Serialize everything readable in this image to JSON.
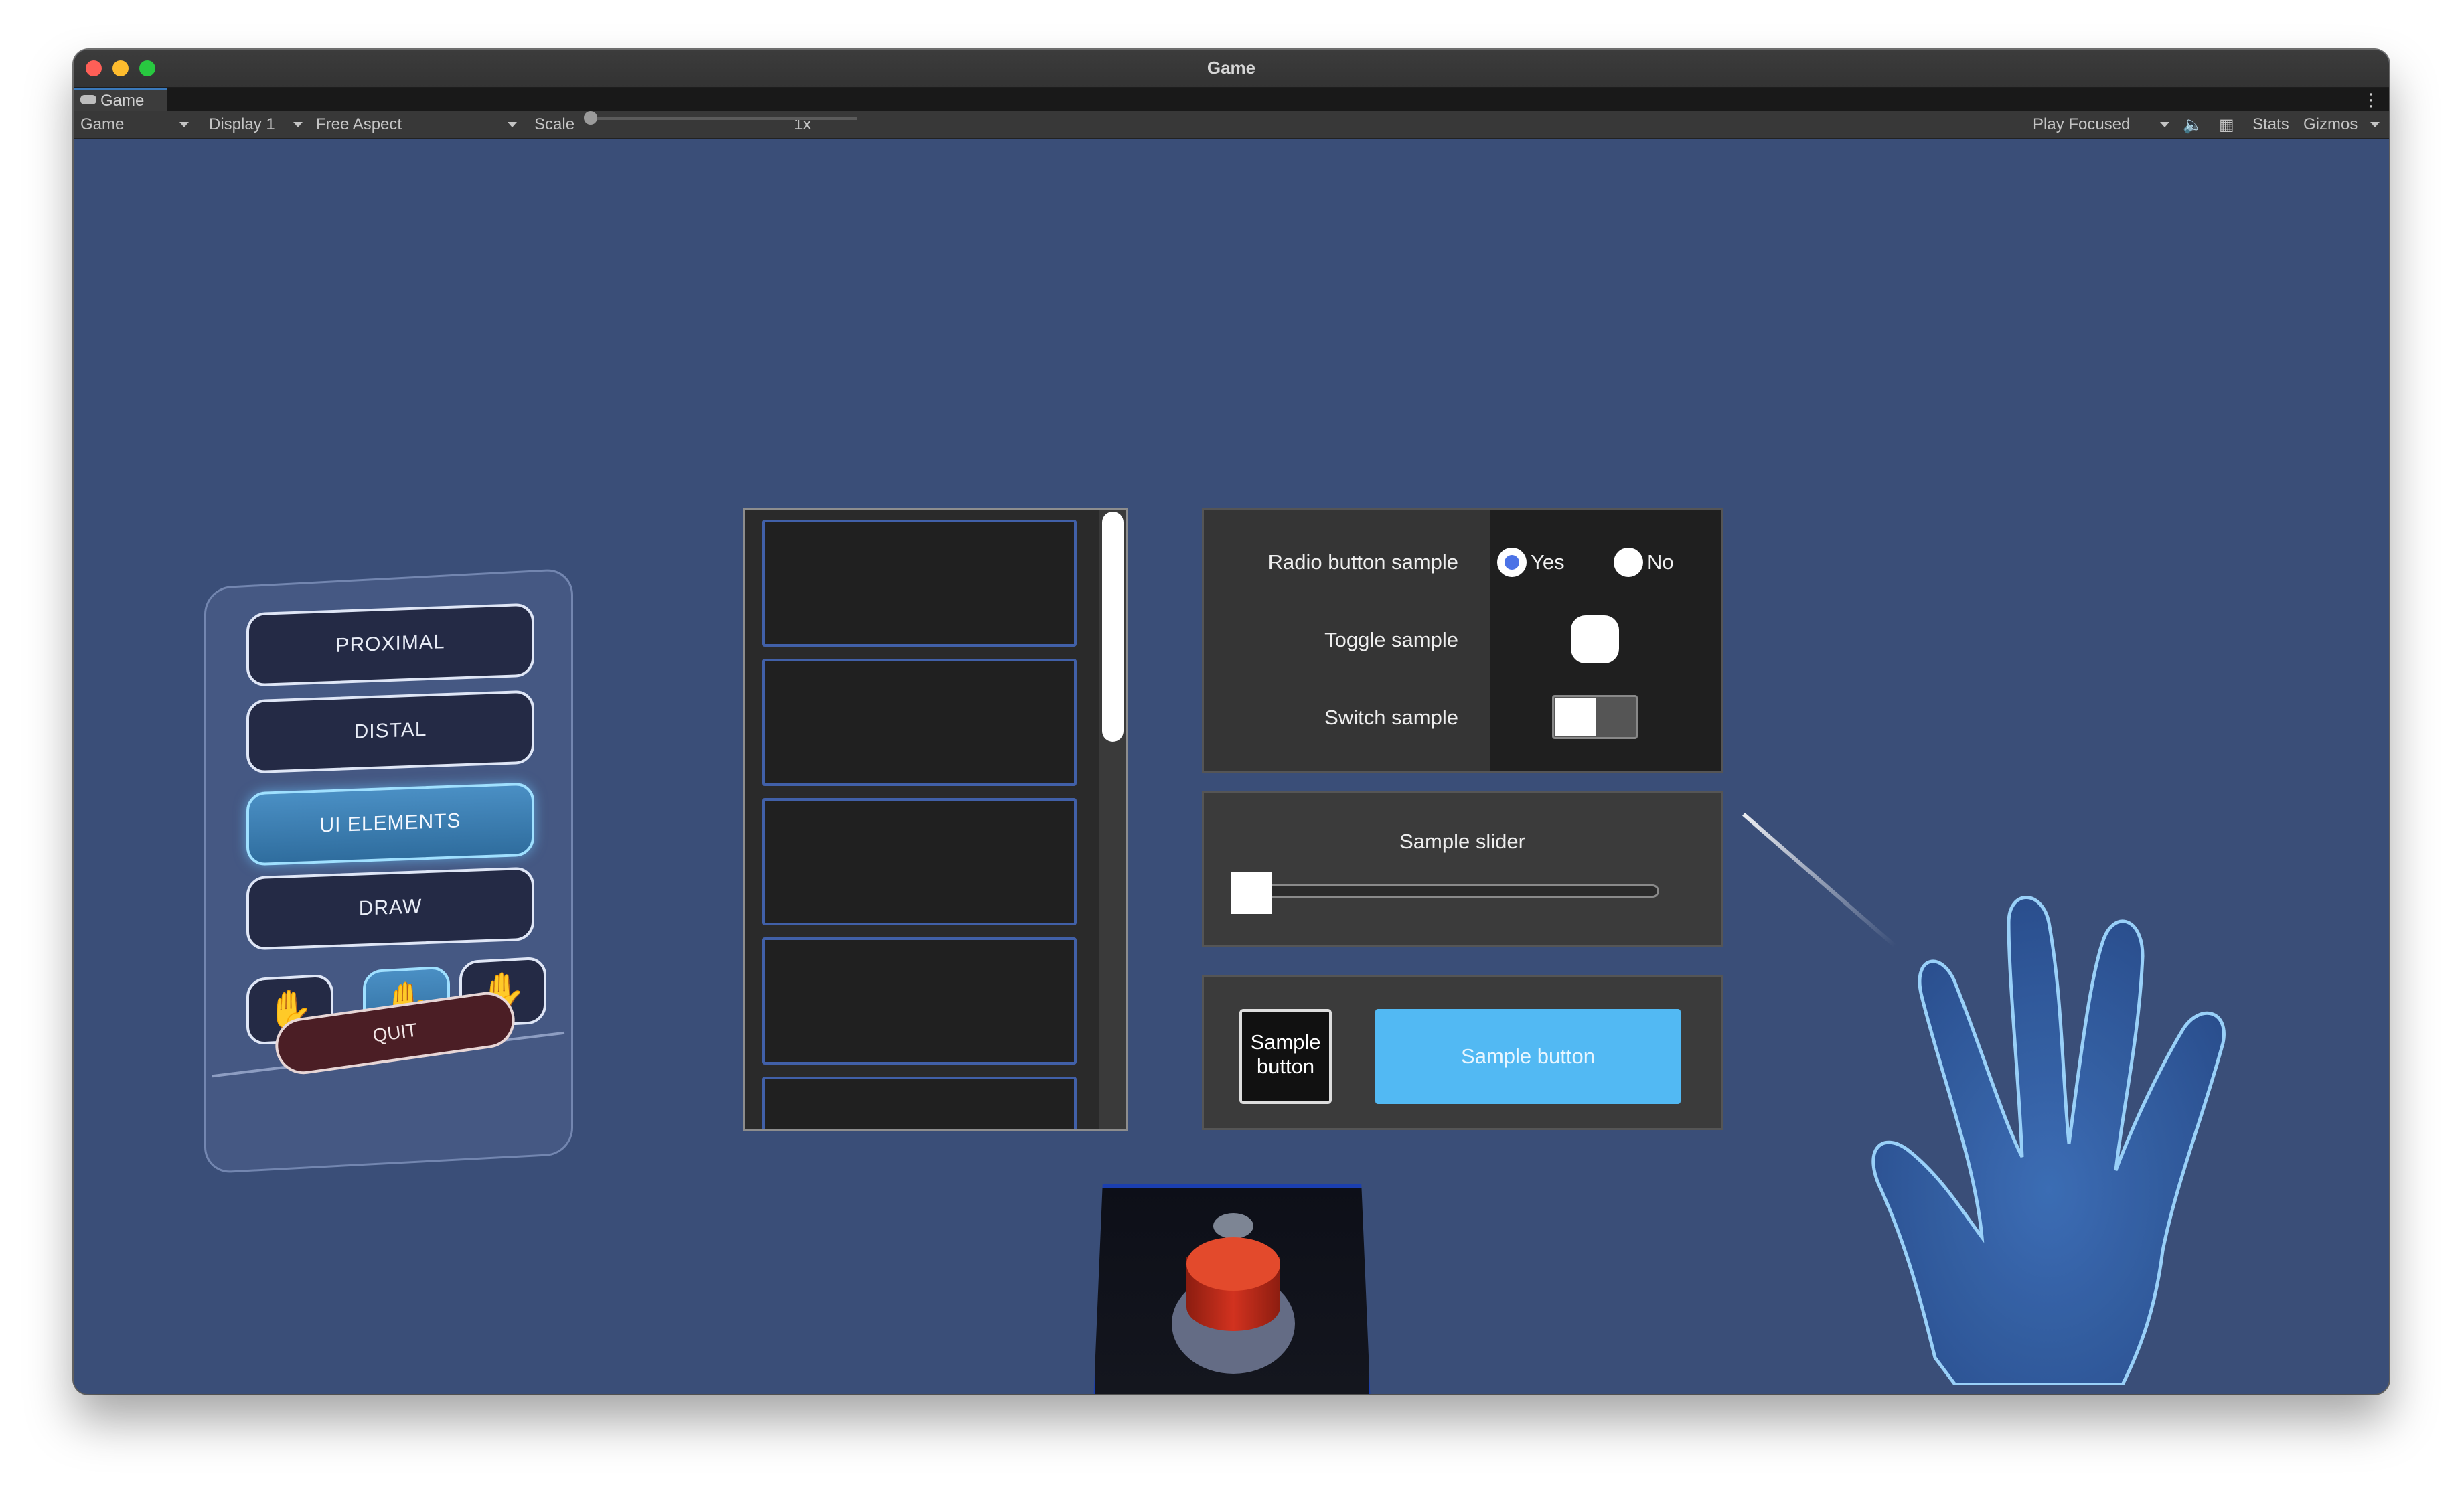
{
  "window": {
    "title": "Game",
    "tab_label": "Game",
    "colors": {
      "background": "#3a4e78",
      "accent_blue": "#52b9f3",
      "list_border": "#4160a8",
      "quit_red": "#4b1e25"
    }
  },
  "toolbar": {
    "view_mode": "Game",
    "display": "Display 1",
    "aspect": "Free Aspect",
    "scale_label": "Scale",
    "scale_value": "1x",
    "play_mode": "Play Focused",
    "stats": "Stats",
    "gizmos": "Gizmos"
  },
  "menu": {
    "buttons": [
      {
        "label": "PROXIMAL",
        "active": false
      },
      {
        "label": "DISTAL",
        "active": false
      },
      {
        "label": "UI ELEMENTS",
        "active": true
      },
      {
        "label": "DRAW",
        "active": false
      }
    ],
    "hand_buttons": [
      {
        "icon": "hand-skin-icon",
        "active": false
      },
      {
        "icon": "hand-outline-icon",
        "active": true
      },
      {
        "icon": "hand-ghost-icon",
        "active": false
      }
    ],
    "quit_label": "QUIT"
  },
  "scroll_list": {
    "item_count_visible": 5,
    "scroll_position": 0
  },
  "controls": {
    "radio_label": "Radio button sample",
    "radio_options": [
      {
        "label": "Yes",
        "selected": true
      },
      {
        "label": "No",
        "selected": false
      }
    ],
    "toggle_label": "Toggle sample",
    "toggle_on": false,
    "switch_label": "Switch sample",
    "switch_on": false,
    "slider_label": "Sample slider",
    "slider_value": 0,
    "small_button_label": "Sample button",
    "big_button_label": "Sample button"
  }
}
